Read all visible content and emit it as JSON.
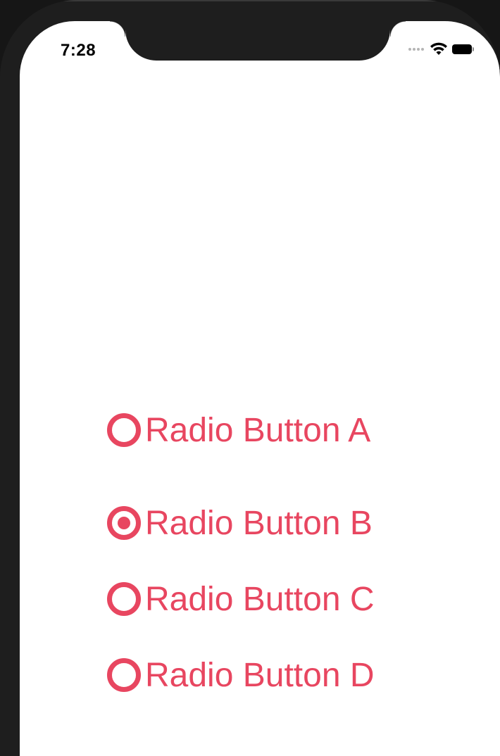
{
  "status_bar": {
    "time": "7:28",
    "signal_icon": "cellular-dots-icon",
    "wifi_icon": "wifi-icon",
    "battery_icon": "battery-icon",
    "battery_level": 1.0
  },
  "radio_group": {
    "accent_color": "#e84660",
    "selected": "Radio Button B",
    "options": [
      {
        "label": "Radio Button A",
        "checked": false
      },
      {
        "label": "Radio Button B",
        "checked": true
      },
      {
        "label": "Radio Button C",
        "checked": false
      },
      {
        "label": "Radio Button D",
        "checked": false
      }
    ]
  }
}
